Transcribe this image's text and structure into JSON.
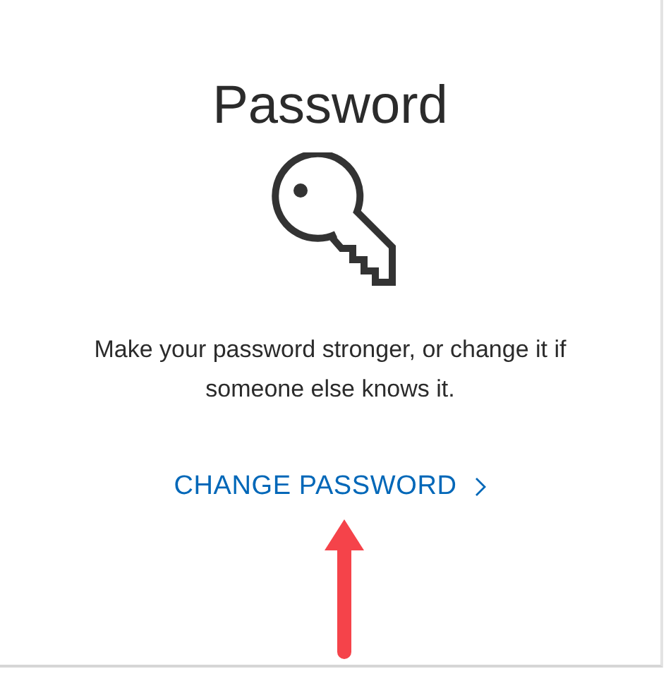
{
  "card": {
    "title": "Password",
    "description": "Make your password stronger, or change it if someone else knows it.",
    "link": {
      "label": "CHANGE PASSWORD"
    }
  }
}
